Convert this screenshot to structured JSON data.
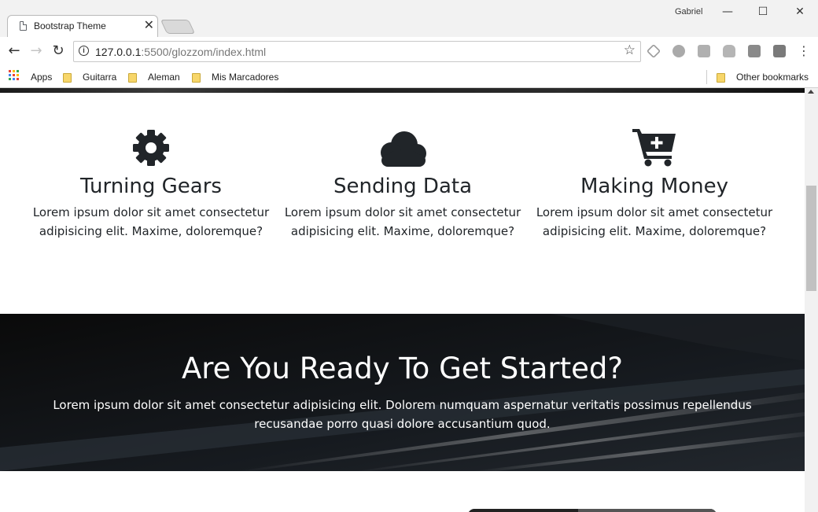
{
  "browser": {
    "tab_title": "Bootstrap Theme",
    "tab_close": "✕",
    "user_name": "Gabriel",
    "window_controls": {
      "minimize": "—",
      "maximize": "☐",
      "close": "✕"
    },
    "url_host": "127.0.0.1",
    "url_rest": ":5500/glozzom/index.html",
    "bookmarks": {
      "apps": "Apps",
      "items": [
        "Guitarra",
        "Aleman",
        "Mis Marcadores"
      ],
      "other": "Other bookmarks"
    },
    "icons": [
      "back-arrow-icon",
      "forward-arrow-icon",
      "reload-icon",
      "info-icon",
      "star-icon",
      "menu-dots-icon"
    ]
  },
  "features": [
    {
      "icon": "gear-icon",
      "title": "Turning Gears",
      "text": "Lorem ipsum dolor sit amet consectetur adipisicing elit. Maxime, doloremque?"
    },
    {
      "icon": "cloud-icon",
      "title": "Sending Data",
      "text": "Lorem ipsum dolor sit amet consectetur adipisicing elit. Maxime, doloremque?"
    },
    {
      "icon": "cart-plus-icon",
      "title": "Making Money",
      "text": "Lorem ipsum dolor sit amet consectetur adipisicing elit. Maxime, doloremque?"
    }
  ],
  "cta": {
    "heading": "Are You Ready To Get Started?",
    "text": "Lorem ipsum dolor sit amet consectetur adipisicing elit. Dolorem numquam aspernatur veritatis possimus repellendus recusandae porro quasi dolore accusantium quod."
  },
  "colors": {
    "icon": "#212529",
    "text": "#212529",
    "cta_bg": "#0d0d0d",
    "cta_text": "#ffffff"
  }
}
